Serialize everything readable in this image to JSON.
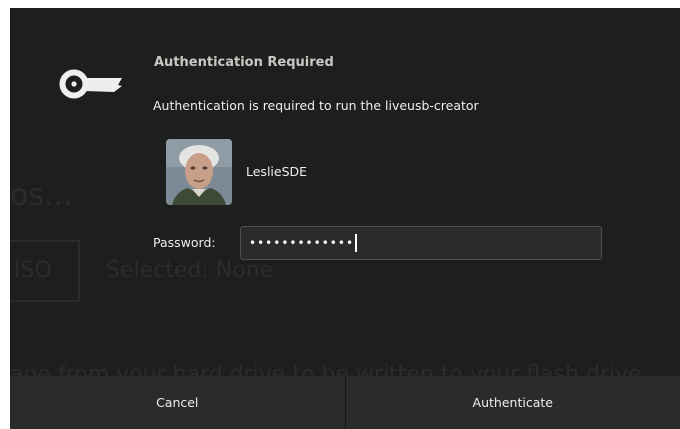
{
  "dialog": {
    "title": "Authentication Required",
    "message": "Authentication is required to run the liveusb-creator",
    "user": {
      "username": "LeslieSDE"
    },
    "password": {
      "label": "Password:",
      "masked_value": "•••••••••••••"
    },
    "buttons": {
      "cancel": "Cancel",
      "authenticate": "Authenticate"
    }
  },
  "background_window": {
    "heading_fragment": "os...",
    "iso_label": "ISO",
    "selected_label": "Selected: None",
    "description_fragment": "age from your hard drive to be written to your flash drive"
  },
  "colors": {
    "dialog_bg": "#1d1e1e",
    "button_bar_bg": "#2a2b2b",
    "input_bg": "#2a2b2b",
    "text": "#eeeeec"
  },
  "icons": {
    "dialog_icon": "key-icon",
    "avatar": "user-avatar"
  }
}
